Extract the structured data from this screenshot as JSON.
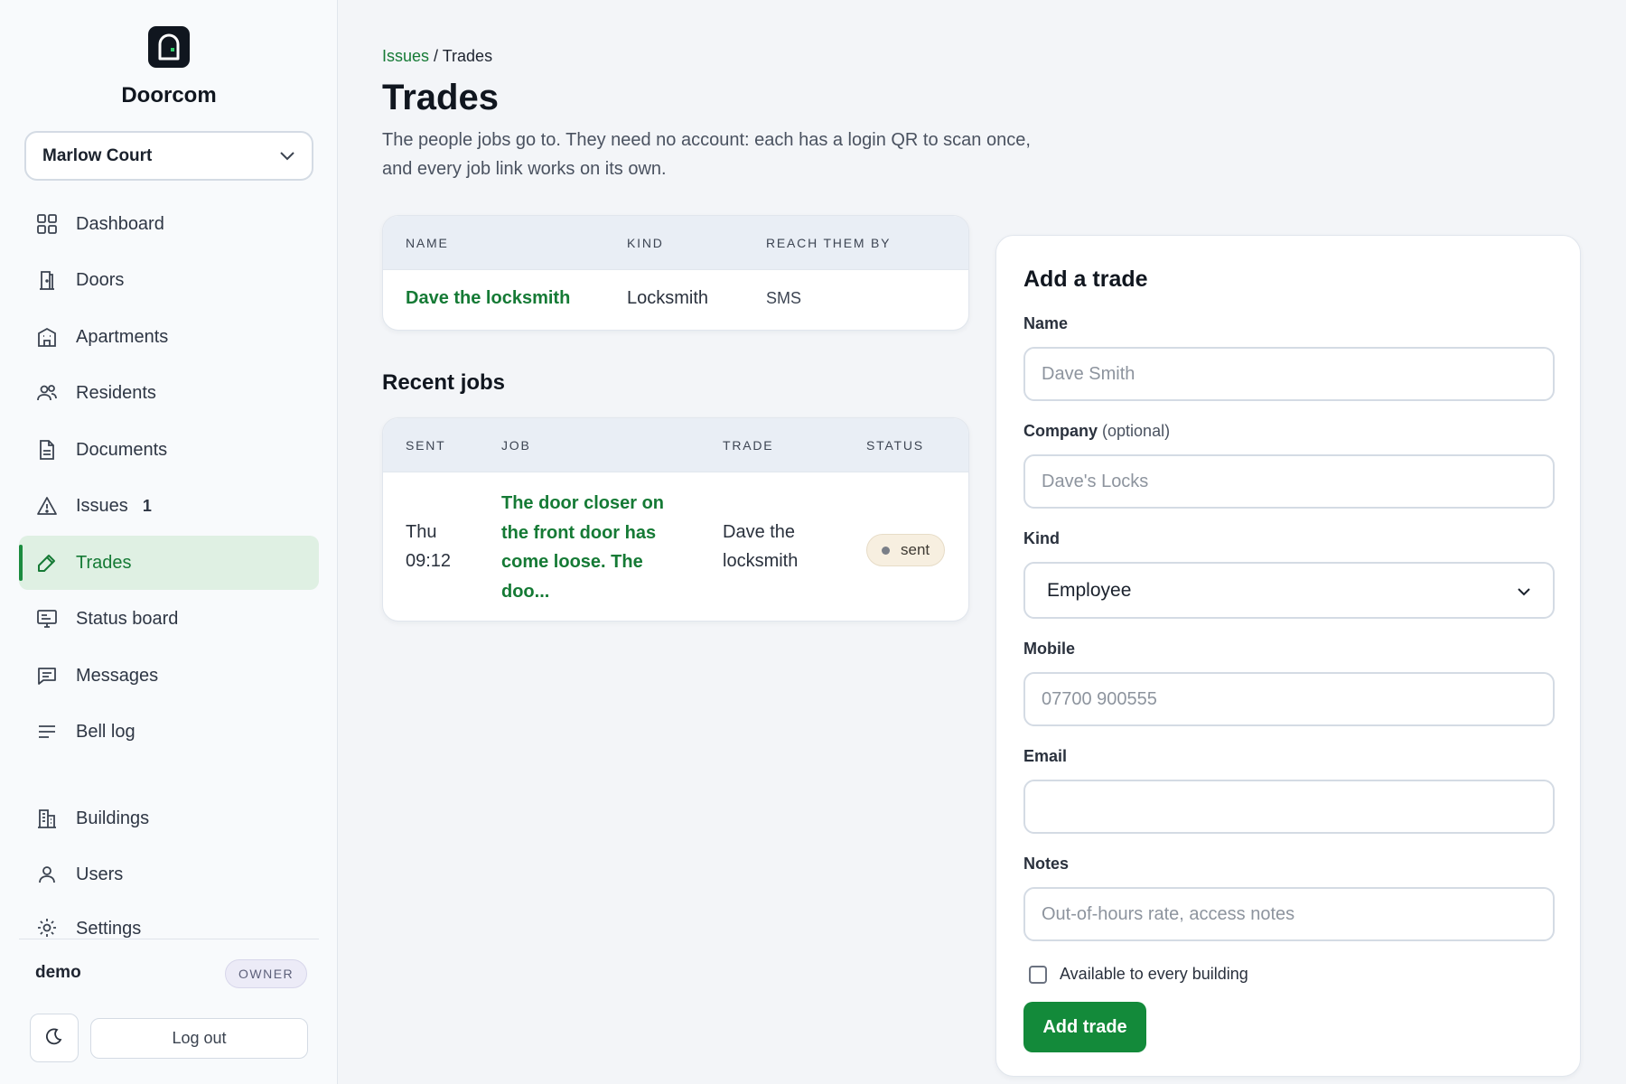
{
  "brand": {
    "name": "Doorcom",
    "icon": "door-icon"
  },
  "building_selector": {
    "value": "Marlow Court"
  },
  "nav": {
    "items": [
      {
        "label": "Dashboard",
        "icon": "grid-icon"
      },
      {
        "label": "Doors",
        "icon": "door-icon"
      },
      {
        "label": "Apartments",
        "icon": "apartment-icon"
      },
      {
        "label": "Residents",
        "icon": "people-icon"
      },
      {
        "label": "Documents",
        "icon": "document-icon"
      },
      {
        "label": "Issues",
        "icon": "warning-icon",
        "badge": "1"
      },
      {
        "label": "Trades",
        "icon": "wrench-icon",
        "active": true
      },
      {
        "label": "Status board",
        "icon": "monitor-icon"
      },
      {
        "label": "Messages",
        "icon": "message-icon"
      },
      {
        "label": "Bell log",
        "icon": "list-icon"
      },
      {
        "label": "Buildings",
        "icon": "building-icon"
      },
      {
        "label": "Users",
        "icon": "user-icon"
      },
      {
        "label": "Settings",
        "icon": "gear-icon"
      }
    ]
  },
  "user": {
    "name": "demo",
    "role": "OWNER",
    "logout_label": "Log out",
    "theme_icon": "moon-icon"
  },
  "breadcrumb": {
    "parent": "Issues",
    "separator": " / ",
    "current": "Trades"
  },
  "page": {
    "title": "Trades",
    "description": "The people jobs go to. They need no account: each has a login QR to scan once, and every job link works on its own."
  },
  "trades_table": {
    "headers": [
      "NAME",
      "KIND",
      "REACH THEM BY"
    ],
    "rows": [
      {
        "name": "Dave the locksmith",
        "kind": "Locksmith",
        "reach": "SMS"
      }
    ]
  },
  "recent_jobs": {
    "title": "Recent jobs",
    "headers": [
      "SENT",
      "JOB",
      "TRADE",
      "STATUS"
    ],
    "rows": [
      {
        "sent_day": "Thu",
        "sent_time": "09:12",
        "job_lines": [
          "The door closer on",
          "the front door has",
          "come loose. The",
          "doo..."
        ],
        "trade_lines": [
          "Dave the",
          "locksmith"
        ],
        "status": "sent"
      }
    ]
  },
  "form": {
    "title": "Add a trade",
    "name_label": "Name",
    "name_placeholder": "Dave Smith",
    "company_label": "Company",
    "company_optional": "(optional)",
    "company_placeholder": "Dave's Locks",
    "kind_label": "Kind",
    "kind_value": "Employee",
    "mobile_label": "Mobile",
    "mobile_placeholder": "07700 900555",
    "email_label": "Email",
    "email_placeholder": "",
    "notes_label": "Notes",
    "notes_placeholder": "Out-of-hours rate, access notes",
    "available_label": "Available to every building",
    "submit_label": "Add trade"
  },
  "colors": {
    "accent": "#157a35",
    "active_bg": "#dff0e3",
    "button": "#138a3a"
  }
}
